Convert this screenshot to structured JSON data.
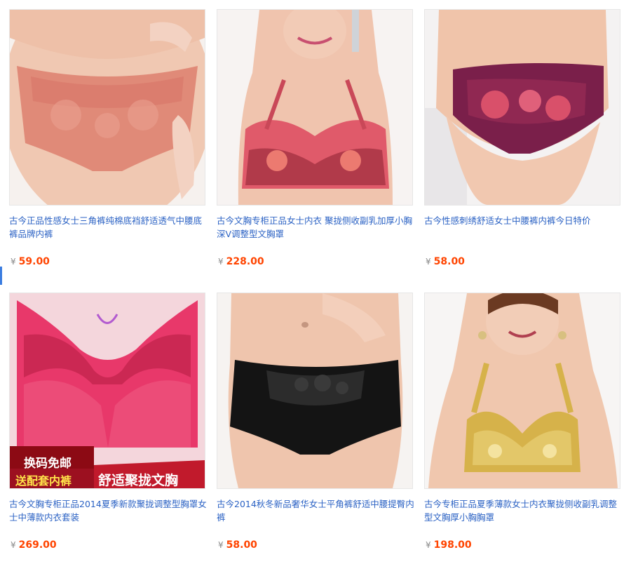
{
  "currency_symbol": "¥",
  "products": [
    {
      "title": "古今正品性感女士三角裤纯棉底裆舒适透气中腰底裤品牌内裤",
      "price": "59.00",
      "image": "peach-lace-brief-photo",
      "image_color": "#e08a78"
    },
    {
      "title": "古今文胸专柜正品女士内衣 聚拢侧收副乳加厚小胸深V调整型文胸罩",
      "price": "228.00",
      "image": "coral-floral-bra-photo",
      "image_color": "#e05a6a"
    },
    {
      "title": "古今性感刺绣舒适女士中腰裤内裤今日特价",
      "price": "58.00",
      "image": "plum-floral-brief-photo",
      "image_color": "#7a1f4a"
    },
    {
      "title": "古今文胸专柜正品2014夏季新款聚拢调整型胸罩女士中薄款内衣套装",
      "price": "269.00",
      "image": "pink-lace-bra-photo",
      "image_color": "#e8386a",
      "promo": {
        "line1": "换码免邮",
        "line2": "送配套内裤",
        "banner": "舒适聚拢文胸"
      }
    },
    {
      "title": "古今2014秋冬新品奢华女士平角裤舒适中腰提臀内裤",
      "price": "58.00",
      "image": "black-lace-boyshort-photo",
      "image_color": "#141414"
    },
    {
      "title": "古今专柜正品夏季薄款女士内衣聚拢侧收副乳调整型文胸厚小胸胸罩",
      "price": "198.00",
      "image": "gold-lace-bra-photo",
      "image_color": "#d6b24a"
    }
  ]
}
